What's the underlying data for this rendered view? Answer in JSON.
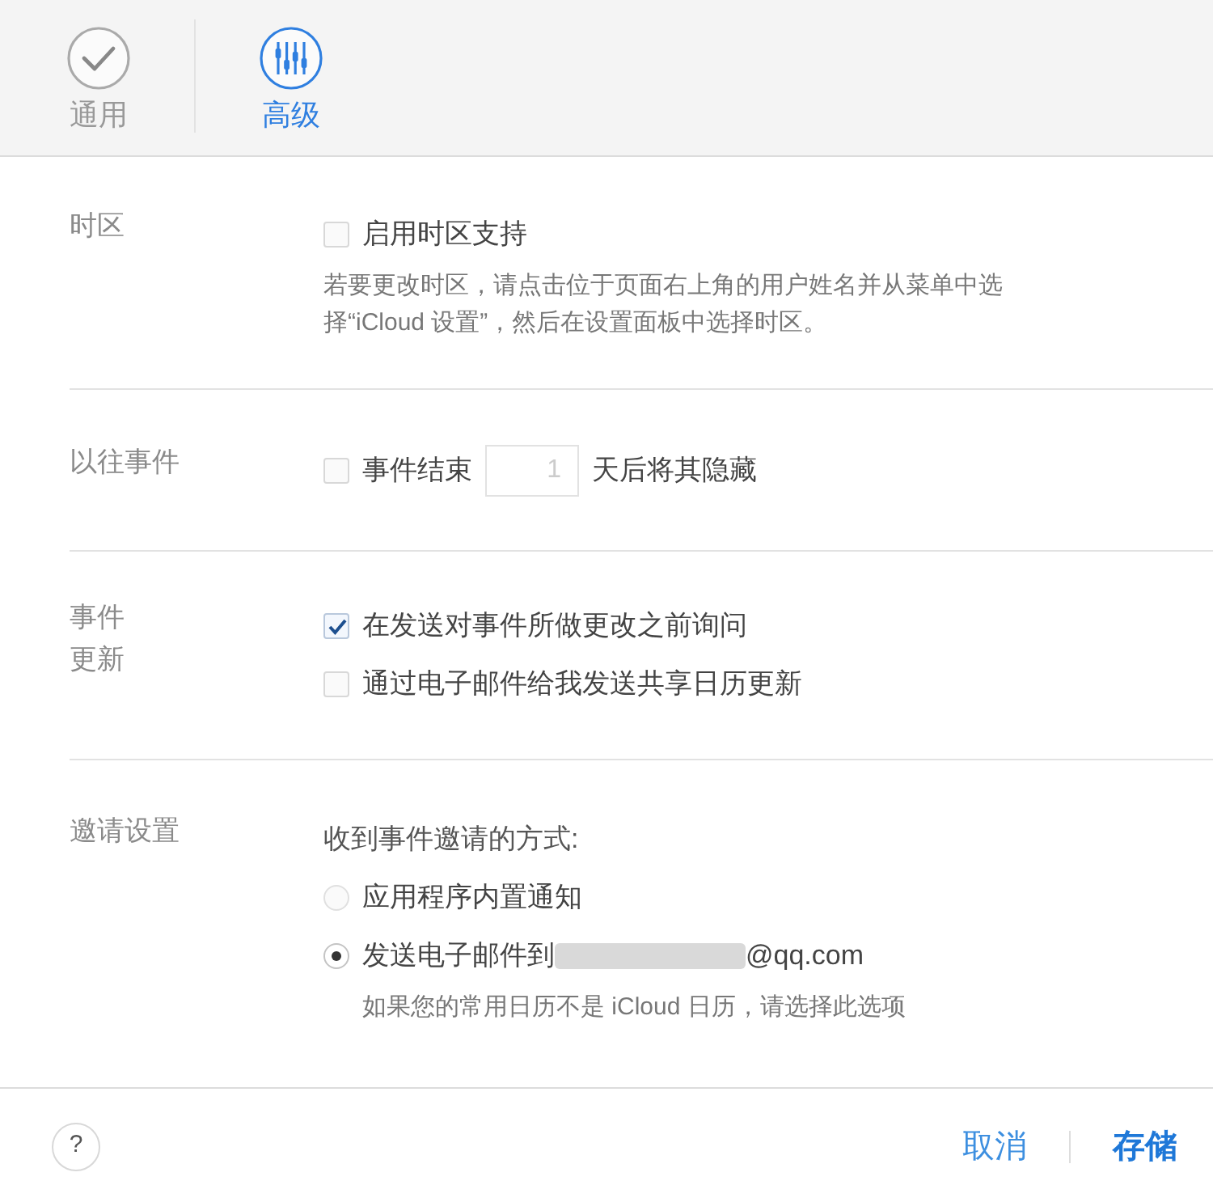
{
  "tabs": [
    {
      "label": "通用",
      "kind": "check",
      "selected": false
    },
    {
      "label": "高级",
      "kind": "sliders",
      "selected": true
    }
  ],
  "sections": [
    {
      "label_lines": [
        "时区"
      ],
      "items": [
        {
          "kind": "checkbox",
          "label": "启用时区支持",
          "checked": false
        },
        {
          "kind": "note",
          "text": "若要更改时区，请点击位于页面右上角的用户姓名并从菜单中选择“iCloud 设置”，然后在设置面板中选择时区。"
        }
      ]
    },
    {
      "label_lines": [
        "以往事件"
      ],
      "items": [
        {
          "kind": "days",
          "checked": false,
          "label_before": "事件结束",
          "value": "1",
          "label_after": "天后将其隐藏"
        }
      ]
    },
    {
      "label_lines": [
        "事件",
        "更新"
      ],
      "items": [
        {
          "kind": "checkbox",
          "label": "在发送对事件所做更改之前询问",
          "checked": true
        },
        {
          "kind": "checkbox",
          "label": "通过电子邮件给我发送共享日历更新",
          "checked": false
        }
      ]
    },
    {
      "label_lines": [
        "邀请设置"
      ],
      "items": [
        {
          "kind": "text",
          "text": "收到事件邀请的方式:"
        },
        {
          "kind": "radio",
          "label": "应用程序内置通知",
          "selected": false
        },
        {
          "kind": "radio",
          "label": "发送电子邮件到",
          "email": "@qq.com",
          "selected": true
        },
        {
          "kind": "note",
          "text": "如果您的常用日历不是 iCloud 日历，请选择此选项"
        }
      ]
    }
  ],
  "footer": {
    "help": "?",
    "cancel": "取消",
    "save": "存储"
  }
}
